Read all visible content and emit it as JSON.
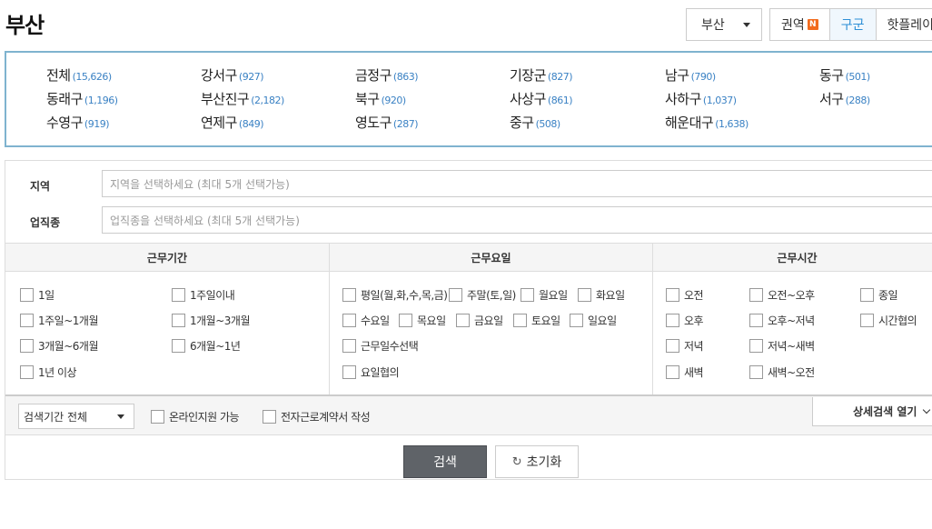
{
  "page": {
    "title": "부산"
  },
  "header": {
    "city_select": "부산",
    "tabs": [
      {
        "label": "권역",
        "badge": "N"
      },
      {
        "label": "구군"
      },
      {
        "label": "핫플레이"
      }
    ],
    "active_tab": "구군"
  },
  "districts": [
    {
      "name": "전체",
      "count": "(15,626)"
    },
    {
      "name": "강서구",
      "count": "(927)"
    },
    {
      "name": "금정구",
      "count": "(863)"
    },
    {
      "name": "기장군",
      "count": "(827)"
    },
    {
      "name": "남구",
      "count": "(790)"
    },
    {
      "name": "동구",
      "count": "(501)"
    },
    {
      "name": "동래구",
      "count": "(1,196)"
    },
    {
      "name": "부산진구",
      "count": "(2,182)"
    },
    {
      "name": "북구",
      "count": "(920)"
    },
    {
      "name": "사상구",
      "count": "(861)"
    },
    {
      "name": "사하구",
      "count": "(1,037)"
    },
    {
      "name": "서구",
      "count": "(288)"
    },
    {
      "name": "수영구",
      "count": "(919)"
    },
    {
      "name": "연제구",
      "count": "(849)"
    },
    {
      "name": "영도구",
      "count": "(287)"
    },
    {
      "name": "중구",
      "count": "(508)"
    },
    {
      "name": "해운대구",
      "count": "(1,638)"
    }
  ],
  "filters": {
    "region_label": "지역",
    "region_placeholder": "지역을 선택하세요 (최대 5개 선택가능)",
    "job_label": "업직종",
    "job_placeholder": "업직종을 선택하세요 (최대 5개 선택가능)"
  },
  "columns": {
    "period": {
      "header": "근무기간",
      "options": [
        "1일",
        "1주일이내",
        "1주일~1개월",
        "1개월~3개월",
        "3개월~6개월",
        "6개월~1년",
        "1년 이상"
      ]
    },
    "days": {
      "header": "근무요일",
      "options": [
        "평일(월,화,수,목,금)",
        "주말(토,일)",
        "월요일",
        "화요일",
        "수요일",
        "목요일",
        "금요일",
        "토요일",
        "일요일",
        "근무일수선택",
        "요일협의"
      ]
    },
    "time": {
      "header": "근무시간",
      "options": [
        "오전",
        "오전~오후",
        "종일",
        "오후",
        "오후~저녁",
        "시간협의",
        "저녁",
        "저녁~새벽",
        "새벽",
        "새벽~오전"
      ]
    }
  },
  "bottom": {
    "period_select": "검색기간 전체",
    "online_label": "온라인지원 가능",
    "contract_label": "전자근로계약서 작성",
    "detail_label": "상세검색 열기"
  },
  "actions": {
    "search": "검색",
    "reset": "초기화"
  },
  "colors": {
    "accent": "#2d8fd6",
    "count_link": "#3b82c4",
    "badge": "#f26b1d",
    "search_button": "#5f6368",
    "box_border": "#7fb3cf"
  }
}
